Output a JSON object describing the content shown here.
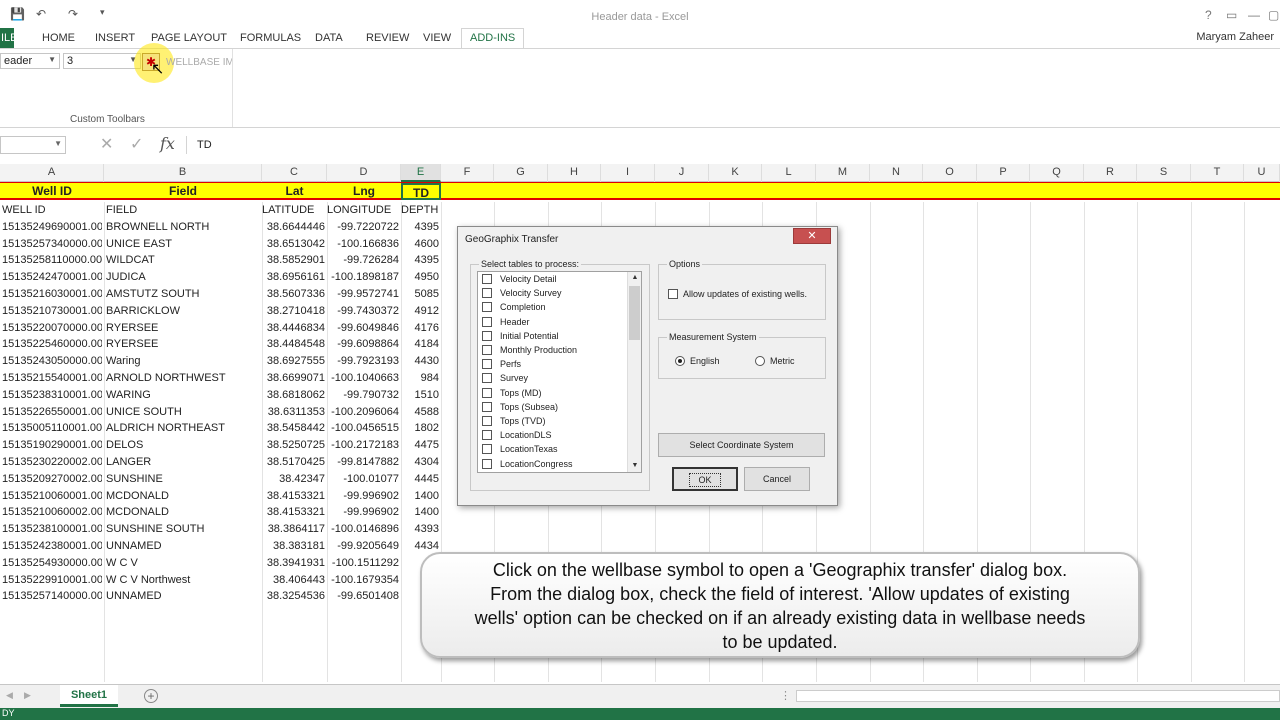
{
  "window": {
    "title": "Header data - Excel",
    "user": "Maryam Zaheer",
    "controls": [
      "?",
      "▭",
      "—",
      "▢"
    ]
  },
  "ribbon": {
    "tabs": [
      "ILE",
      "HOME",
      "INSERT",
      "PAGE LAYOUT",
      "FORMULAS",
      "DATA",
      "REVIEW",
      "VIEW",
      "ADD-INS"
    ],
    "active_tab": "ADD-INS",
    "combo1_value": "eader",
    "combo2_value": "3",
    "wellbase_label": "WELLBASE IM",
    "group_label": "Custom Toolbars"
  },
  "formula_bar": {
    "name_box": "",
    "content": "TD"
  },
  "columns": [
    "A",
    "B",
    "C",
    "D",
    "E",
    "F",
    "G",
    "H",
    "I",
    "J",
    "K",
    "L",
    "M",
    "N",
    "O",
    "P",
    "Q",
    "R",
    "S",
    "T",
    "U"
  ],
  "header_row": [
    "Well ID",
    "Field",
    "Lat",
    "Lng",
    "TD"
  ],
  "sub_header": [
    "WELL ID",
    "FIELD",
    "LATITUDE",
    "LONGITUDE",
    "DEPTH"
  ],
  "rows": [
    [
      "15135249690001.00",
      "BROWNELL NORTH",
      "38.6644446",
      "-99.7220722",
      "4395"
    ],
    [
      "15135257340000.00",
      "UNICE EAST",
      "38.6513042",
      "-100.166836",
      "4600"
    ],
    [
      "15135258110000.00",
      "WILDCAT",
      "38.5852901",
      "-99.726284",
      "4395"
    ],
    [
      "15135242470001.00",
      "JUDICA",
      "38.6956161",
      "-100.1898187",
      "4950"
    ],
    [
      "15135216030001.00",
      "AMSTUTZ SOUTH",
      "38.5607336",
      "-99.9572741",
      "5085"
    ],
    [
      "15135210730001.00",
      "BARRICKLOW",
      "38.2710418",
      "-99.7430372",
      "4912"
    ],
    [
      "15135220070000.00",
      "RYERSEE",
      "38.4446834",
      "-99.6049846",
      "4176"
    ],
    [
      "15135225460000.00",
      "RYERSEE",
      "38.4484548",
      "-99.6098864",
      "4184"
    ],
    [
      "15135243050000.00",
      "Waring",
      "38.6927555",
      "-99.7923193",
      "4430"
    ],
    [
      "15135215540001.00",
      "ARNOLD NORTHWEST",
      "38.6699071",
      "-100.1040663",
      "984"
    ],
    [
      "15135238310001.00",
      "WARING",
      "38.6818062",
      "-99.790732",
      "1510"
    ],
    [
      "15135226550001.00",
      "UNICE SOUTH",
      "38.6311353",
      "-100.2096064",
      "4588"
    ],
    [
      "15135005110001.00",
      "ALDRICH NORTHEAST",
      "38.5458442",
      "-100.0456515",
      "1802"
    ],
    [
      "15135190290001.00",
      "DELOS",
      "38.5250725",
      "-100.2172183",
      "4475"
    ],
    [
      "15135230220002.00",
      "LANGER",
      "38.5170425",
      "-99.8147882",
      "4304"
    ],
    [
      "15135209270002.00",
      "SUNSHINE",
      "38.42347",
      "-100.01077",
      "4445"
    ],
    [
      "15135210060001.00",
      "MCDONALD",
      "38.4153321",
      "-99.996902",
      "1400"
    ],
    [
      "15135210060002.00",
      "MCDONALD",
      "38.4153321",
      "-99.996902",
      "1400"
    ],
    [
      "15135238100001.00",
      "SUNSHINE SOUTH",
      "38.3864117",
      "-100.0146896",
      "4393"
    ],
    [
      "15135242380001.00",
      "UNNAMED",
      "38.383181",
      "-99.9205649",
      "4434"
    ],
    [
      "15135254930000.00",
      "W C V",
      "38.3941931",
      "-100.1511292",
      "4"
    ],
    [
      "15135229910001.00",
      "W C V Northwest",
      "38.406443",
      "-100.1679354",
      "1"
    ],
    [
      "15135257140000.00",
      "UNNAMED",
      "38.3254536",
      "-99.6501408",
      "4"
    ]
  ],
  "sheet": {
    "tab": "Sheet1",
    "status": "DY"
  },
  "dialog": {
    "title": "GeoGraphix Transfer",
    "close": "✕",
    "tables_label": "Select tables to process:",
    "tables": [
      "Velocity Detail",
      "Velocity Survey",
      "Completion",
      "Header",
      "Initial Potential",
      "Monthly Production",
      "Perfs",
      "Survey",
      "Tops (MD)",
      "Tops (Subsea)",
      "Tops (TVD)",
      "LocationDLS",
      "LocationTexas",
      "LocationCongress"
    ],
    "options_label": "Options",
    "allow_updates": "Allow updates of existing wells.",
    "measurement_label": "Measurement System",
    "english": "English",
    "metric": "Metric",
    "coord_button": "Select Coordinate System",
    "ok": "OK",
    "cancel": "Cancel"
  },
  "callout": {
    "text": "Click on the wellbase symbol to open a 'Geographix transfer' dialog box. From the dialog box, check the field of interest. 'Allow updates of existing wells' option can be checked on if an already existing data in wellbase needs to be updated."
  }
}
